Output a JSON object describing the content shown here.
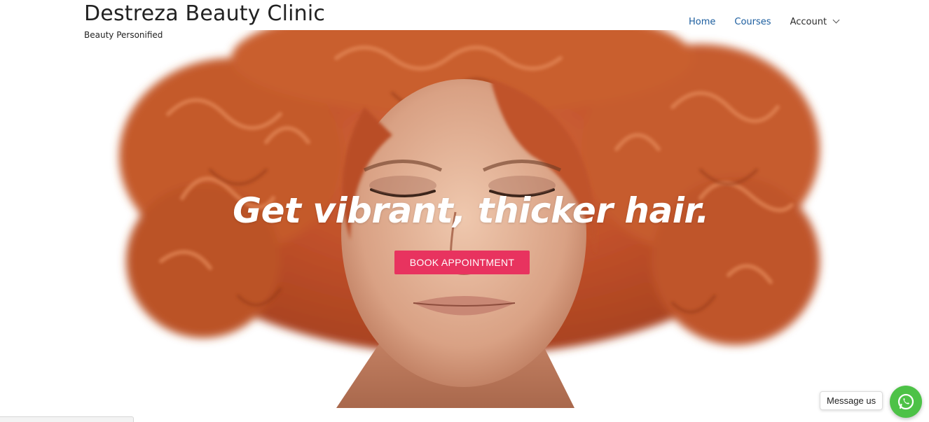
{
  "site": {
    "title": "Destreza Beauty Clinic",
    "tagline": "Beauty Personified"
  },
  "nav": {
    "items": [
      {
        "label": "Home"
      },
      {
        "label": "Courses"
      }
    ],
    "account_label": "Account"
  },
  "hero": {
    "headline": "Get vibrant, thicker hair.",
    "cta_label": "BOOK APPOINTMENT",
    "image": "portrait-red-curly-hair"
  },
  "chat_widget": {
    "bubble_label": "Message us",
    "icon": "whatsapp-icon"
  },
  "colors": {
    "cta": "#e8335f",
    "nav_link": "#1a5c9e",
    "whatsapp": "#4dc247",
    "hair": "#c8582b"
  }
}
